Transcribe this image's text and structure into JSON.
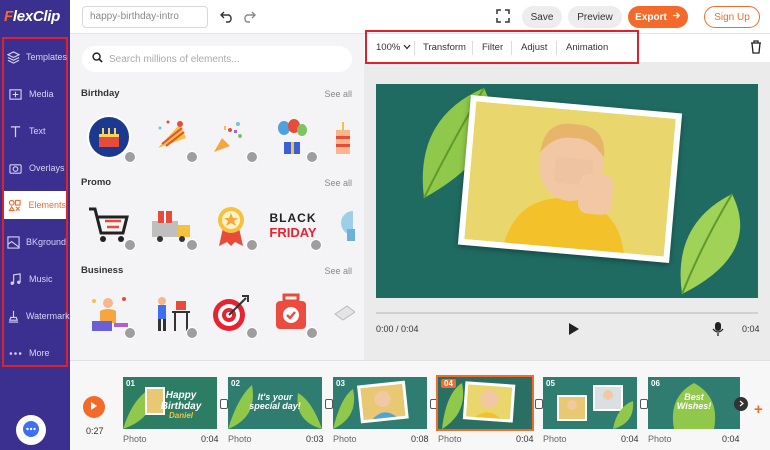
{
  "app": {
    "logo_left": "F",
    "logo_right": "lexClip"
  },
  "sidebar": {
    "items": [
      {
        "label": "Templates",
        "icon": "layers-icon"
      },
      {
        "label": "Media",
        "icon": "media-icon"
      },
      {
        "label": "Text",
        "icon": "text-icon"
      },
      {
        "label": "Overlays",
        "icon": "overlays-icon"
      },
      {
        "label": "Elements",
        "icon": "elements-icon",
        "active": true
      },
      {
        "label": "BKground",
        "icon": "background-icon"
      },
      {
        "label": "Music",
        "icon": "music-icon"
      },
      {
        "label": "Watermark",
        "icon": "watermark-icon"
      },
      {
        "label": "More",
        "icon": "more-icon"
      }
    ]
  },
  "topbar": {
    "project_name": "happy-birthday-intro",
    "save": "Save",
    "preview": "Preview",
    "export": "Export",
    "signup": "Sign Up"
  },
  "panel": {
    "search_placeholder": "Search millions of elements...",
    "sections": [
      {
        "title": "Birthday",
        "see_all": "See all"
      },
      {
        "title": "Promo",
        "see_all": "See all"
      },
      {
        "title": "Business",
        "see_all": "See all"
      }
    ],
    "black_friday_top": "BLACK",
    "black_friday_bottom": "FRIDAY"
  },
  "toolbar": {
    "zoom": "100%",
    "transform": "Transform",
    "filter": "Filter",
    "adjust": "Adjust",
    "animation": "Animation"
  },
  "player": {
    "time_current": "0:00 / 0:04",
    "duration": "0:04"
  },
  "timeline": {
    "total": "0:27",
    "clips": [
      {
        "num": "01",
        "text": "Happy\nBirthday\nDaniel",
        "type": "Photo",
        "duration": "0:04"
      },
      {
        "num": "02",
        "text": "It's your\nspecial day!",
        "type": "Photo",
        "duration": "0:03"
      },
      {
        "num": "03",
        "text": "",
        "type": "Photo",
        "duration": "0:08"
      },
      {
        "num": "04",
        "text": "",
        "type": "Photo",
        "duration": "0:04",
        "active": true
      },
      {
        "num": "05",
        "text": "",
        "type": "Photo",
        "duration": "0:04"
      },
      {
        "num": "06",
        "text": "Best\nWishes!",
        "type": "Photo",
        "duration": "0:04"
      }
    ]
  },
  "colors": {
    "accent": "#f36a2a",
    "sidebar": "#3b2f8f",
    "highlight_outline": "#e0202a",
    "stage_bg": "#1f6b62"
  }
}
